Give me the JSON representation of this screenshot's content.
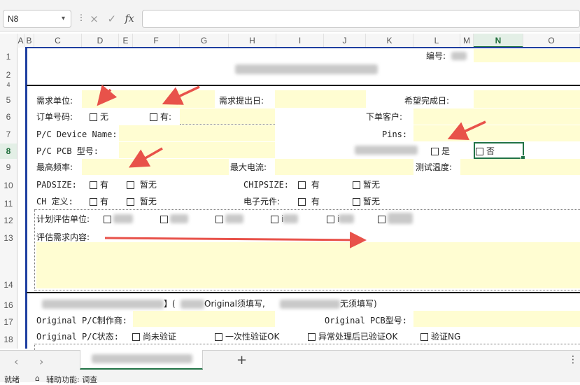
{
  "formula_bar": {
    "name_box": "N8",
    "fx": "fx",
    "more": "⋮",
    "cancel_icon": "×",
    "enter_icon": "✓"
  },
  "columns": [
    "A",
    "B",
    "C",
    "D",
    "E",
    "F",
    "G",
    "H",
    "I",
    "J",
    "K",
    "L",
    "M",
    "N",
    "O"
  ],
  "rows": [
    "1",
    "2",
    "4",
    "5",
    "6",
    "7",
    "8",
    "9",
    "10",
    "11",
    "12",
    "13",
    "14",
    "16",
    "17",
    "18"
  ],
  "selected_cell": {
    "column": "N",
    "row": "8"
  },
  "form": {
    "number_label": "编号:",
    "request_unit": "需求单位:",
    "request_date": "需求提出日:",
    "expected_date": "希望完成日:",
    "order_no": "订单号码:",
    "none": "无",
    "has": "有:",
    "order_customer": "下单客户:",
    "pc_device_name": "P/C Device Name:",
    "pins": "Pins:",
    "pc_pcb": "P/C PCB 型号:",
    "yes": "是",
    "no": "否",
    "max_freq": "最高频率:",
    "max_current": "最大电流:",
    "test_temp": "测试温度:",
    "padsize": "PADSIZE:",
    "has2": "有",
    "none_yet": "暂无",
    "chipsize": "CHIPSIZE:",
    "ch_def": "CH 定义:",
    "components": "电子元件:",
    "plan_unit": "计划评估单位:",
    "eval_content": "评估需求内容:",
    "section_title": "】(",
    "original_fill": "Original须填写,",
    "no_fill": "无须填写)",
    "orig_maker": "Original P/C制作商:",
    "orig_pcb": "Original PCB型号:",
    "orig_status": "Original P/C状态:",
    "not_verified": "尚未验证",
    "one_time_verify": "一次性验证OK",
    "abnormal_verify": "异常处理后已验证OK",
    "verify_ng": "验证NG",
    "row12_partial": [
      "计",
      "i",
      "i"
    ]
  },
  "tabs": {
    "add": "+",
    "menu": "⋮"
  },
  "status_bar": {
    "ready": "就绪",
    "accessibility": "辅助功能: 调查"
  },
  "colors": {
    "accent": "#217346",
    "yellow_fill": "#fffdd2",
    "arrow": "#e8524a",
    "frame_blue": "#1f3fa0"
  },
  "icons": [
    "chevron-down-icon",
    "more-icon",
    "cancel-icon",
    "enter-icon",
    "function-icon",
    "checkbox-icon",
    "arrow-annotation-icon",
    "prev-sheet-icon",
    "next-sheet-icon",
    "add-sheet-icon"
  ]
}
